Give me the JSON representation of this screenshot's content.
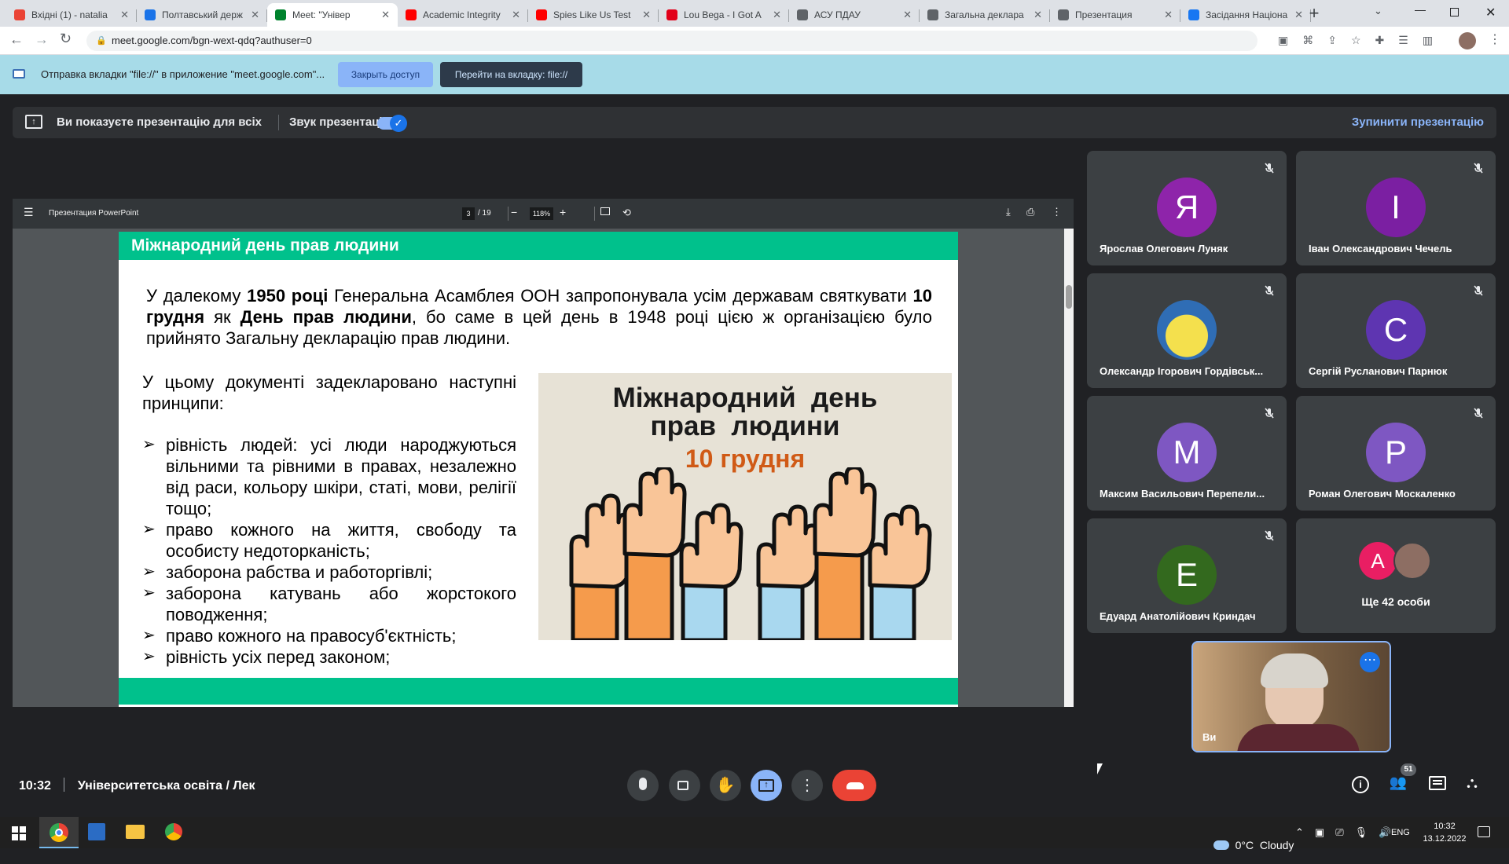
{
  "browser": {
    "tabs": [
      {
        "title": "Вхідні (1) - natalia",
        "color": "#ea4335",
        "active": false
      },
      {
        "title": "Полтавський держ",
        "color": "#1a73e8",
        "active": false
      },
      {
        "title": "Meet: \"Універ",
        "color": "#00832d",
        "active": true
      },
      {
        "title": "Academic Integrity",
        "color": "#ff0000",
        "active": false
      },
      {
        "title": "Spies Like Us Test",
        "color": "#ff0000",
        "active": false
      },
      {
        "title": "Lou Bega - I Got A",
        "color": "#e2001a",
        "active": false
      },
      {
        "title": "АСУ ПДАУ",
        "color": "#5f6368",
        "active": false
      },
      {
        "title": "Загальна деклара",
        "color": "#5f6368",
        "active": false
      },
      {
        "title": "Презентация",
        "color": "#5f6368",
        "active": false
      },
      {
        "title": "Засідання Націона",
        "color": "#1877f2",
        "active": false
      }
    ],
    "url": "meet.google.com/bgn-wext-qdq?authuser=0"
  },
  "infobar": {
    "message": "Отправка вкладки \"file://\" в приложение \"meet.google.com\"...",
    "close_label": "Закрыть доступ",
    "switch_label": "Перейти на вкладку: file://"
  },
  "presenting": {
    "status": "Ви показуєте презентацію для всіх",
    "audio_label": "Звук презентації",
    "audio_on": true,
    "stop_label": "Зупинити презентацію"
  },
  "pdf_viewer": {
    "title": "Презентация PowerPoint",
    "page_current": "3",
    "page_total": "/ 19",
    "zoom": "118%"
  },
  "slide": {
    "title": "Міжнародний день прав людини",
    "para1": {
      "t1": "У далекому ",
      "b1": "1950 році",
      "t2": " Генеральна Асамблея ООН запропонувала усім державам святкувати ",
      "b2": "10 грудня",
      "t3": " як ",
      "b3": "День прав людини",
      "t4": ", бо саме в цей день в 1948 році цією ж організацією було прийнято Загальну декларацію прав людини."
    },
    "intro": "У цьому документі задекларовано наступні принципи:",
    "bullet_marker": "➢",
    "bullets": [
      "рівність людей: усі люди народжуються вільними та рівними в правах, незалежно від раси, кольору шкіри, статі, мови, релігії тощо;",
      "право кожного на життя, свободу та особисту недоторканість;",
      "заборона рабства и работоргівлі;",
      "заборона катувань або жорстокого поводження;",
      "право кожного на правосуб'єктність;",
      "рівність усіх перед законом;"
    ],
    "image": {
      "line1": "Міжнародний  день",
      "line2": "прав  людини",
      "date": "10 грудня"
    },
    "accent_color": "#00c18c"
  },
  "participants": [
    {
      "initial": "Я",
      "name": "Ярослав Олегович Луняк",
      "color": "#8e24aa",
      "muted": true
    },
    {
      "initial": "І",
      "name": "Іван Олександрович Чечель",
      "color": "#7b1fa2",
      "muted": true
    },
    {
      "initial": "",
      "name": "Олександр Ігорович Гордівськ...",
      "color": "#1565c0",
      "muted": true,
      "photo": true
    },
    {
      "initial": "С",
      "name": "Сергій Русланович Парнюк",
      "color": "#5e35b1",
      "muted": true
    },
    {
      "initial": "М",
      "name": "Максим Васильович Перепели...",
      "color": "#7e57c2",
      "muted": true
    },
    {
      "initial": "Р",
      "name": "Роман Олегович Москаленко",
      "color": "#7e57c2",
      "muted": true
    },
    {
      "initial": "Е",
      "name": "Едуард Анатолійович Криндач",
      "color": "#33691e",
      "muted": true
    }
  ],
  "more_tile": {
    "initial": "A",
    "label": "Ще 42 особи"
  },
  "self_tile": {
    "name": "Ви"
  },
  "bottom": {
    "time": "10:32",
    "meeting_name": "Університетська освіта / Лек",
    "participants_badge": "51"
  },
  "taskbar": {
    "weather": "0°C  Cloudy",
    "lang": "ENG",
    "clock_time": "10:32",
    "clock_date": "13.12.2022"
  }
}
